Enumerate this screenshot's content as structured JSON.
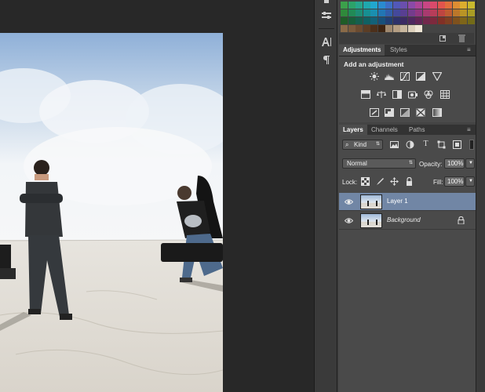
{
  "adjustments_panel": {
    "tabs": [
      "Adjustments",
      "Styles"
    ],
    "title": "Add an adjustment"
  },
  "layers_panel": {
    "tabs": [
      "Layers",
      "Channels",
      "Paths"
    ],
    "filter_kind": "Kind",
    "blend_mode": "Normal",
    "opacity_label": "Opacity:",
    "opacity_value": "100%",
    "lock_label": "Lock:",
    "fill_label": "Fill:",
    "fill_value": "100%",
    "layers": [
      {
        "name": "Layer 1",
        "selected": true,
        "locked": false
      },
      {
        "name": "Background",
        "selected": false,
        "locked": true
      }
    ]
  },
  "swatch_colors": [
    "#3ca04b",
    "#2ca36a",
    "#27a58c",
    "#1fa8ae",
    "#21a7cf",
    "#2a8bd0",
    "#3d6fc6",
    "#5258b8",
    "#6a4fae",
    "#8b4aa7",
    "#ac4597",
    "#c84684",
    "#da4a6b",
    "#e2544d",
    "#e06e3c",
    "#de8d33",
    "#dcae2e",
    "#c8b92d",
    "#2f8a3b",
    "#218a56",
    "#1e8c74",
    "#178f92",
    "#1a8fb0",
    "#2276b3",
    "#325ea9",
    "#44499b",
    "#583f92",
    "#743c8c",
    "#903780",
    "#a83a6f",
    "#b83d59",
    "#be4541",
    "#bd5b32",
    "#bb772a",
    "#b99425",
    "#a99d24",
    "#1f5c27",
    "#185e3a",
    "#155f4e",
    "#106163",
    "#126178",
    "#18507a",
    "#223f73",
    "#2e326a",
    "#3c2b63",
    "#4e285f",
    "#612556",
    "#72284b",
    "#7d293d",
    "#813026",
    "#803f22",
    "#7f511d",
    "#7e6519",
    "#736b18",
    "#8a6a48",
    "#7a5a3c",
    "#6b4b30",
    "#5b3d25",
    "#4c301b",
    "#3e2512",
    "#a08a70",
    "#b59f84",
    "#c9b89f",
    "#ddd0bb",
    "#efe6d6"
  ]
}
